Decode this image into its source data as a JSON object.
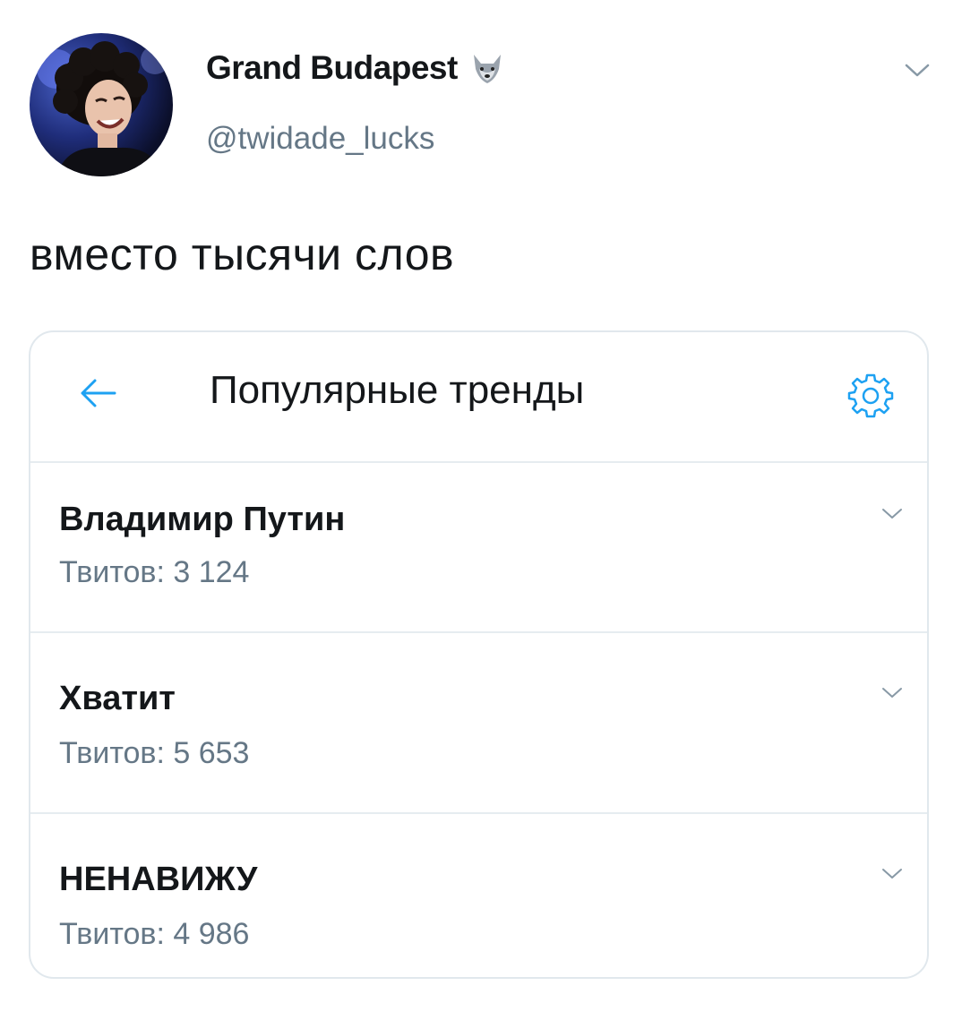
{
  "tweet": {
    "author_name": "Grand Budapest",
    "author_handle": "@twidade_lucks",
    "text": "вместо тысячи слов",
    "icons": {
      "name_emoji": "wolf-icon",
      "menu": "chevron-down-icon"
    }
  },
  "card": {
    "title": "Популярные тренды",
    "icons": {
      "back": "arrow-left-icon",
      "settings": "gear-icon"
    },
    "accent_color": "#1da1f2",
    "trends": [
      {
        "name": "Владимир Путин",
        "count": "Твитов: 3 124"
      },
      {
        "name": "Хватит",
        "count": "Твитов: 5 653"
      },
      {
        "name": "НЕНАВИЖУ",
        "count": "Твитов: 4 986"
      }
    ]
  }
}
